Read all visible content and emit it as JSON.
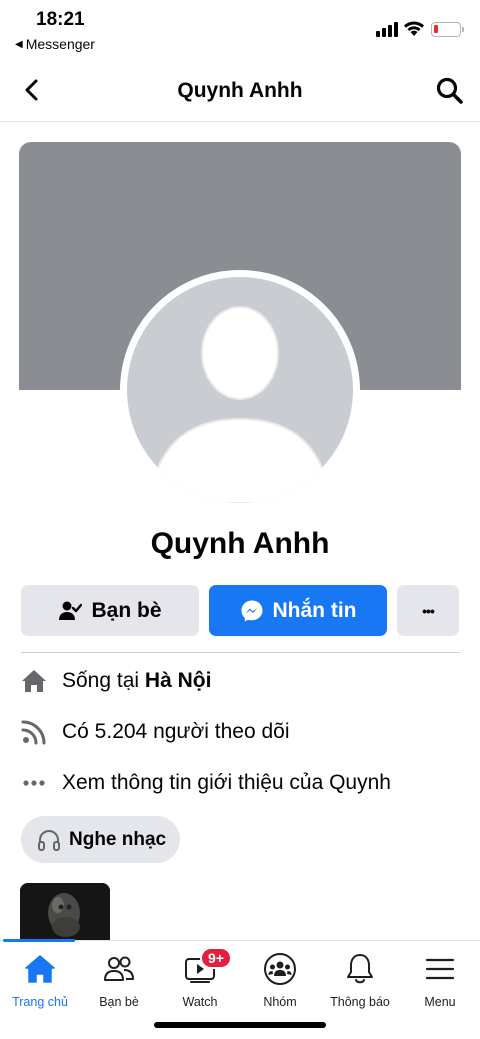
{
  "status_bar": {
    "time": "18:21",
    "back_app": "Messenger",
    "back_glyph": "◀"
  },
  "header": {
    "title": "Quynh Anhh",
    "back_icon": "chevron-left-icon",
    "search_icon": "search-icon"
  },
  "profile": {
    "name": "Quynh Anhh"
  },
  "actions": {
    "friends_label": "Bạn bè",
    "message_label": "Nhắn tin",
    "more_label": "•••"
  },
  "info": {
    "lives_prefix": "Sống tại",
    "lives_city": "Hà Nội",
    "followers": "Có 5.204 người theo dõi",
    "about": "Xem thông tin giới thiệu của Quynh"
  },
  "chip": {
    "label": "Nghe nhạc",
    "icon": "headphones-icon"
  },
  "tabbar": {
    "items": [
      {
        "label": "Trang chủ",
        "icon": "home-icon",
        "active": true
      },
      {
        "label": "Bạn bè",
        "icon": "friends-icon",
        "active": false
      },
      {
        "label": "Watch",
        "icon": "watch-icon",
        "active": false
      },
      {
        "label": "Nhóm",
        "icon": "groups-icon",
        "active": false
      },
      {
        "label": "Thông báo",
        "icon": "bell-icon",
        "active": false
      },
      {
        "label": "Menu",
        "icon": "menu-icon",
        "active": false
      }
    ],
    "watch_badge": "9+"
  },
  "colors": {
    "accent": "#1877f2",
    "badge": "#e41e3f",
    "button_gray": "#e4e6eb",
    "cover_gray": "#8a8d91"
  }
}
